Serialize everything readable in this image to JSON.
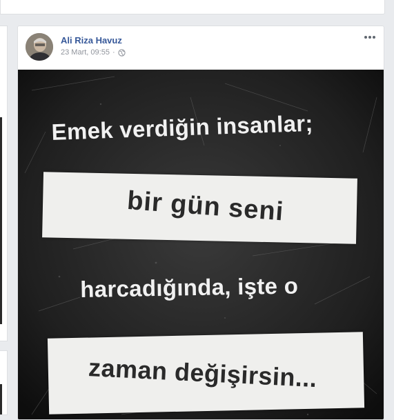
{
  "post": {
    "author_name": "Ali Riza Havuz",
    "timestamp": "23 Mart, 09:55",
    "separator": "·",
    "privacy_icon": "globe-icon",
    "more_icon": "more-options-icon",
    "avatar_icon": "avatar-photo"
  },
  "image_text": {
    "line1": "Emek verdiğin insanlar;",
    "line2": "bir gün seni",
    "line3": "harcadığında, işte o",
    "line4": "zaman değişirsin..."
  },
  "colors": {
    "author_link": "#365899",
    "meta_text": "#90949c",
    "page_bg": "#e9ebee",
    "image_bg": "#1b1b1b",
    "paper_strip": "#efefed"
  }
}
